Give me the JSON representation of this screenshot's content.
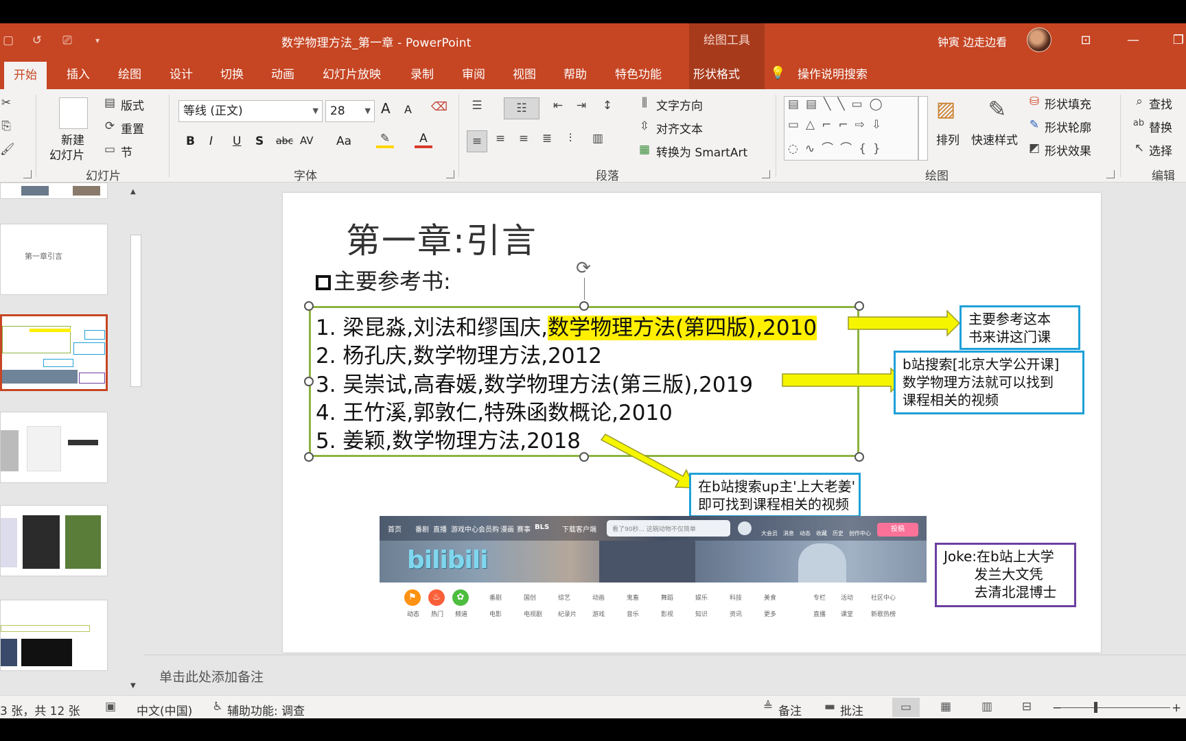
{
  "window": {
    "title": "数学物理方法_第一章  -  PowerPoint",
    "context_tab_group": "绘图工具",
    "user_name": "钟寅 边走边看",
    "accent_color": "#c64523"
  },
  "quick_access": [
    "save-icon",
    "undo-icon",
    "present-from-beginning-icon",
    "customize-quick-access-icon"
  ],
  "tabs": [
    {
      "label": "开始",
      "active": true
    },
    {
      "label": "插入"
    },
    {
      "label": "绘图"
    },
    {
      "label": "设计"
    },
    {
      "label": "切换"
    },
    {
      "label": "动画"
    },
    {
      "label": "幻灯片放映"
    },
    {
      "label": "录制"
    },
    {
      "label": "审阅"
    },
    {
      "label": "视图"
    },
    {
      "label": "帮助"
    },
    {
      "label": "特色功能"
    },
    {
      "label": "形状格式"
    }
  ],
  "tell_me": "操作说明搜索",
  "ribbon": {
    "slides_group": {
      "label": "幻灯片",
      "new_slide_line1": "新建",
      "new_slide_line2": "幻灯片",
      "layout": "版式",
      "reset": "重置",
      "section": "节"
    },
    "font_group": {
      "label": "字体",
      "font_name": "等线 (正文)",
      "font_size": "28",
      "bold": "B",
      "italic": "I",
      "underline": "U",
      "shadow": "S",
      "strike": "abc",
      "spacing": "AV",
      "case": "Aa",
      "grow": "A",
      "shrink": "A"
    },
    "paragraph_group": {
      "label": "段落",
      "text_direction": "文字方向",
      "align_text": "对齐文本",
      "convert_smartart": "转换为 SmartArt"
    },
    "drawing_group": {
      "label": "绘图",
      "arrange": "排列",
      "quick_styles": "快速样式",
      "shape_fill": "形状填充",
      "shape_outline": "形状轮廓",
      "shape_effects": "形状效果"
    },
    "editing_group": {
      "label": "编辑",
      "find": "查找",
      "replace": "替换",
      "select": "选择"
    }
  },
  "thumbnails": {
    "slide2_text": "第一章引言",
    "selected_index": 3
  },
  "slide": {
    "title": "第一章:引言",
    "heading": "主要参考书:",
    "references": [
      {
        "plain": "1. 梁昆淼,刘法和缪国庆,",
        "highlight": "数学物理方法(第四版),2010"
      },
      {
        "plain": "2. 杨孔庆,数学物理方法,2012",
        "highlight": ""
      },
      {
        "plain": "3. 吴崇试,高春媛,数学物理方法(第三版),2019",
        "highlight": ""
      },
      {
        "plain": "4. 王竹溪,郭敦仁,特殊函数概论,2010",
        "highlight": ""
      },
      {
        "plain": "5. 姜颖,数学物理方法,2018",
        "highlight": ""
      }
    ],
    "notes": [
      {
        "text": "主要参考这本\n书来讲这门课",
        "color": "#1ea0d8"
      },
      {
        "text": "b站搜索[北京大学公开课]\n数学物理方法就可以找到\n课程相关的视频",
        "color": "#1ea0d8"
      },
      {
        "text": "在b站搜索up主'上大老姜'\n即可找到课程相关的视频",
        "color": "#1ea0d8"
      },
      {
        "text": "Joke:在b站上大学\n       发兰大文凭\n       去清北混博士",
        "color": "#6b3fa0"
      }
    ],
    "highlight_color": "#ffef00",
    "arrow_color": "#f5f500",
    "selection_border_color": "#8cb33f"
  },
  "bilibili": {
    "nav": [
      "首页",
      "番剧",
      "直播",
      "游戏中心",
      "会员购",
      "漫画",
      "赛事",
      "BLS",
      "下载客户端"
    ],
    "search_placeholder": "看了90秒... 这碗动物不仅简单",
    "right_nav": [
      "大会员",
      "消息",
      "动态",
      "收藏",
      "历史",
      "创作中心"
    ],
    "upload": "投稿",
    "logo": "bilibili",
    "circles": [
      {
        "label": "动态",
        "color": "#ff9212"
      },
      {
        "label": "热门",
        "color": "#f9603a"
      },
      {
        "label": "频道",
        "color": "#4dbd3f"
      }
    ],
    "categories_row1": [
      "番剧",
      "国创",
      "综艺",
      "动画",
      "鬼畜",
      "舞蹈",
      "娱乐",
      "科技",
      "美食"
    ],
    "categories_row2": [
      "电影",
      "电视剧",
      "纪录片",
      "游戏",
      "音乐",
      "影视",
      "知识",
      "资讯",
      "更多"
    ],
    "side_links_row1": [
      "专栏",
      "活动",
      "社区中心"
    ],
    "side_links_row2": [
      "直播",
      "课堂",
      "新歌热榜"
    ]
  },
  "notes_placeholder": "单击此处添加备注",
  "status": {
    "slide_count": "3 张，共 12 张",
    "language": "中文(中国)",
    "accessibility": "辅助功能: 调查",
    "notes": "备注",
    "comments": "批注",
    "zoom_minus": "−",
    "zoom_plus": "+"
  }
}
